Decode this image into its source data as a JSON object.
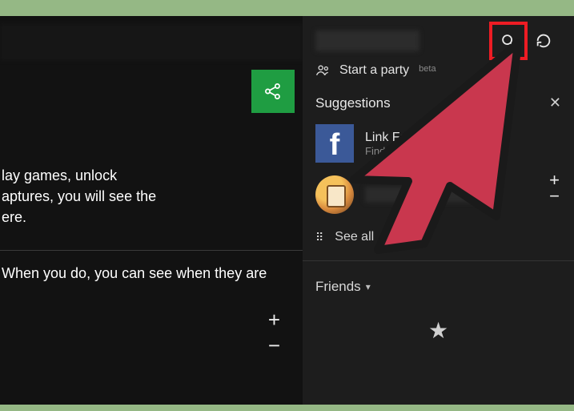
{
  "left": {
    "line1": "lay games, unlock",
    "line2": "aptures, you will see the",
    "line3": "ere.",
    "line4": "When you do, you can see when they are"
  },
  "right": {
    "party_label": "Start a party",
    "party_beta": "beta",
    "suggestions_title": "Suggestions",
    "fb_title": "Link Facebook account",
    "fb_sub": "Find Facebook friends",
    "see_all": "See all",
    "friends_title": "Friends"
  },
  "colors": {
    "share_green": "#1f9d42",
    "highlight_red": "#ed1c24",
    "arrow_fill": "#c9374e",
    "arrow_stroke": "#1a1a1a",
    "fb_blue": "#3b5998"
  }
}
